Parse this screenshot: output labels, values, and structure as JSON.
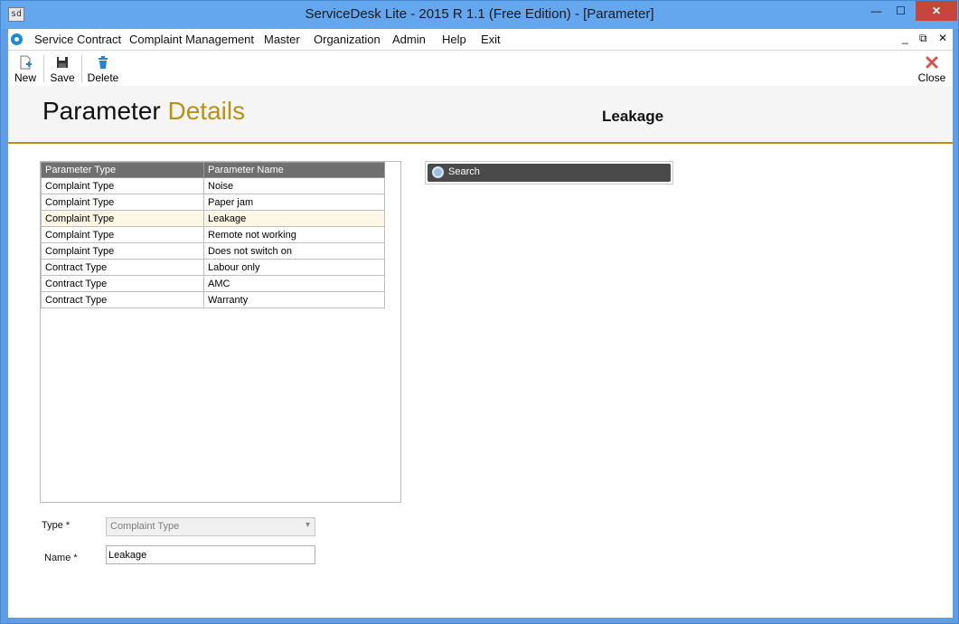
{
  "window": {
    "icon_text": "sd",
    "title": "ServiceDesk Lite - 2015 R 1.1 (Free Edition) - [Parameter]",
    "minimize_glyph": "—",
    "maximize_glyph": "☐",
    "close_glyph": "✕"
  },
  "menu": {
    "items": [
      {
        "label": "Service Contract"
      },
      {
        "label": "Complaint Management"
      },
      {
        "label": "Master"
      },
      {
        "label": "Organization"
      },
      {
        "label": "Admin"
      },
      {
        "label": "Help"
      },
      {
        "label": "Exit"
      }
    ],
    "mdi_minimize": "_",
    "mdi_restore": "⧉",
    "mdi_close": "✕"
  },
  "toolbar": {
    "new_label": "New",
    "save_label": "Save",
    "delete_label": "Delete",
    "close_label": "Close",
    "accent_blue": "#1e88d6",
    "accent_red": "#d9534f"
  },
  "header": {
    "title_part1": "Parameter",
    "title_part2": "Details",
    "record_name": "Leakage",
    "accent_color": "#b8911a"
  },
  "grid": {
    "columns": [
      "Parameter Type",
      "Parameter Name"
    ],
    "rows": [
      [
        "Complaint Type",
        "Noise"
      ],
      [
        "Complaint Type",
        "Paper jam"
      ],
      [
        "Complaint Type",
        "Leakage"
      ],
      [
        "Complaint Type",
        "Remote not working"
      ],
      [
        "Complaint Type",
        "Does not switch on"
      ],
      [
        "Contract Type",
        "Labour only"
      ],
      [
        "Contract Type",
        "AMC"
      ],
      [
        "Contract Type",
        "Warranty"
      ]
    ],
    "selected_row": 2
  },
  "search": {
    "label": "Search"
  },
  "form": {
    "type_label": "Type *",
    "type_value": "Complaint Type",
    "name_label": "Name *",
    "name_value": "Leakage"
  }
}
